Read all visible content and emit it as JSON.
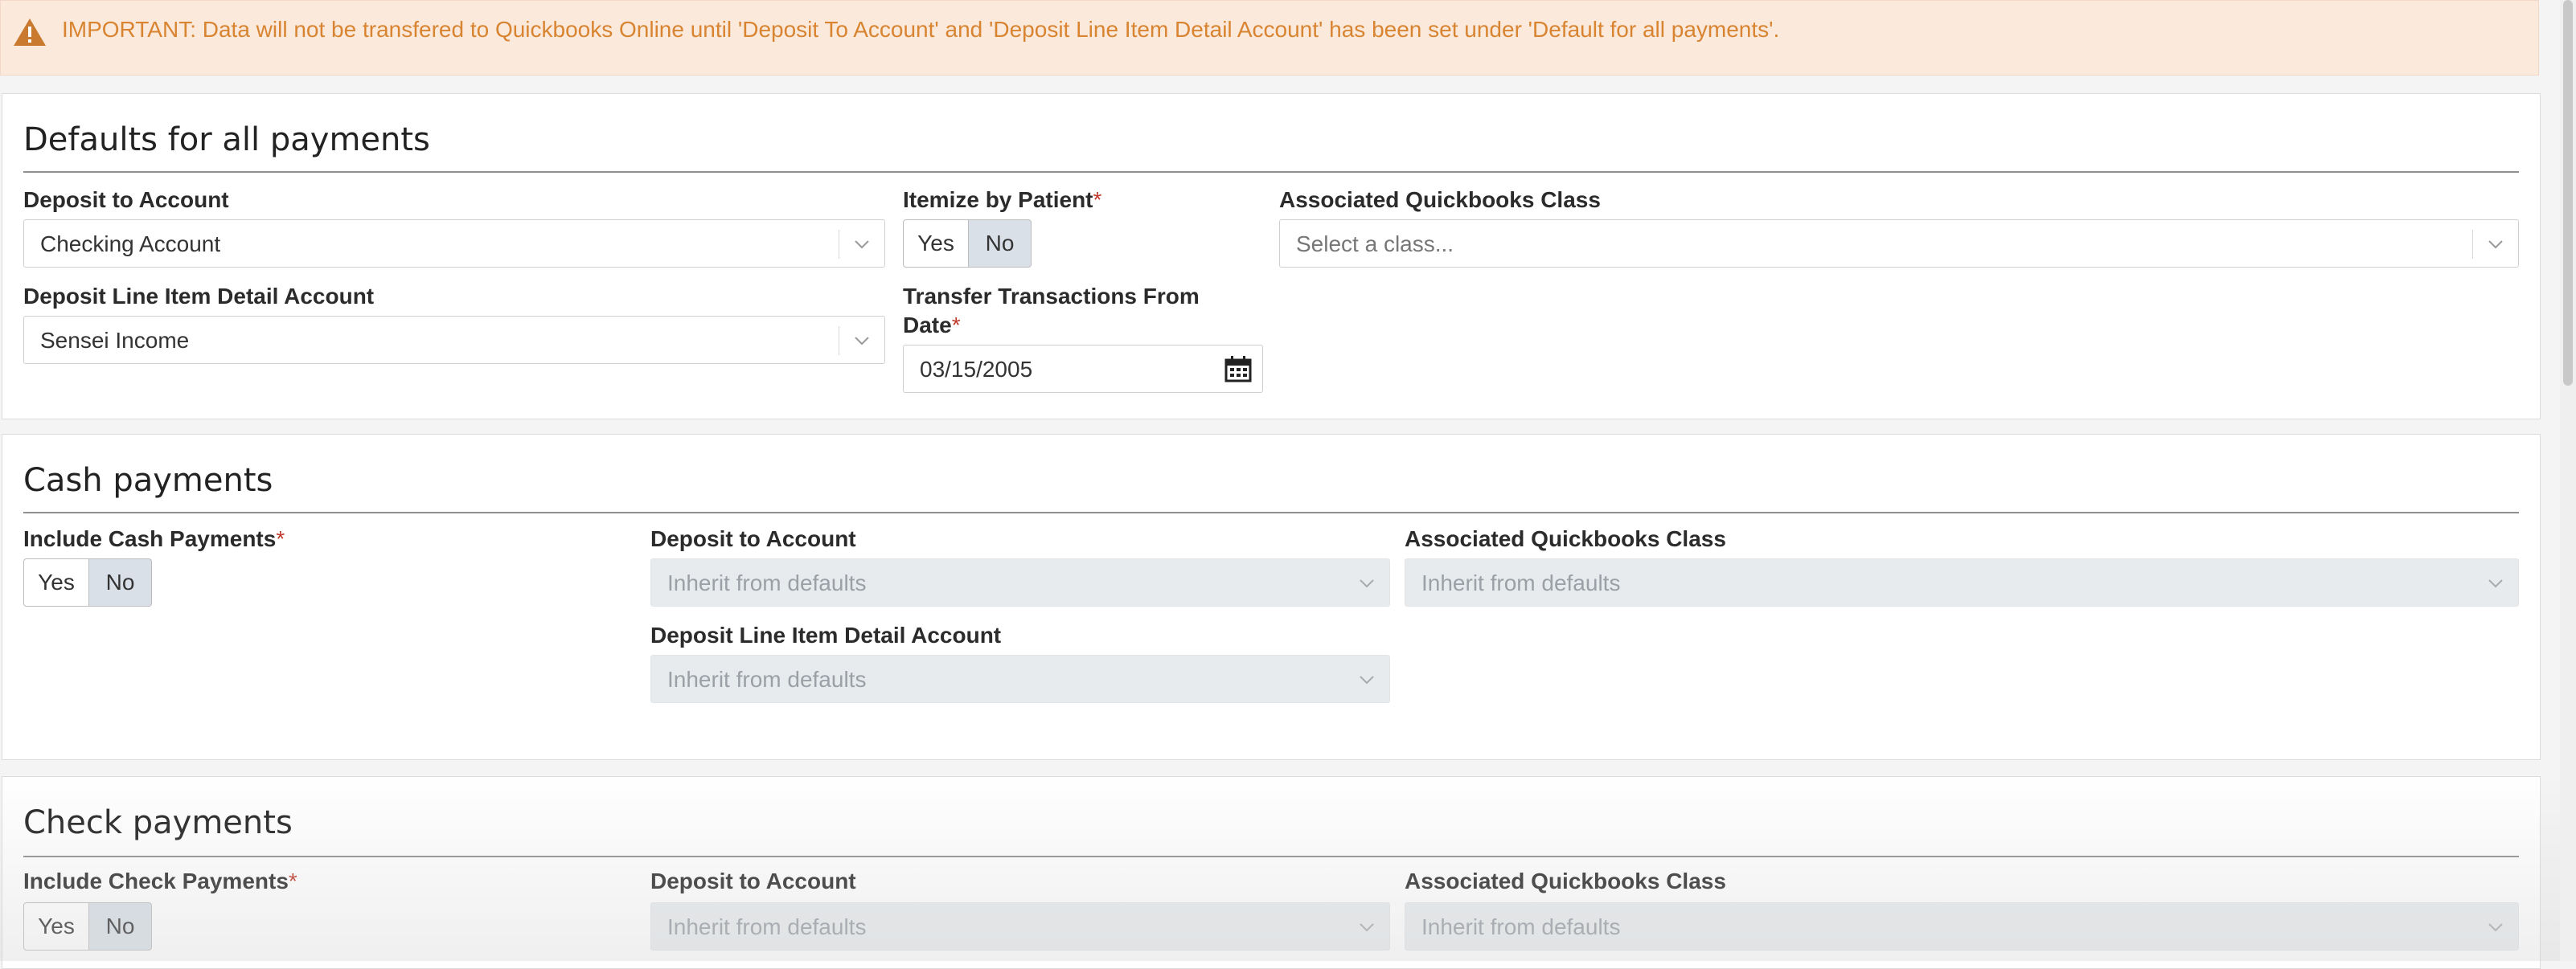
{
  "alert": {
    "icon": "warning-icon",
    "color": "#d88431",
    "message": "IMPORTANT: Data will not be transfered to Quickbooks Online until 'Deposit To Account' and 'Deposit Line Item Detail Account' has been set under 'Default for all payments'."
  },
  "defaults": {
    "title": "Defaults for all payments",
    "deposit_to_account": {
      "label": "Deposit to Account",
      "value": "Checking Account"
    },
    "itemize": {
      "label": "Itemize by Patient",
      "required": "*",
      "yes": "Yes",
      "no": "No",
      "selected": "No"
    },
    "class": {
      "label": "Associated Quickbooks Class",
      "placeholder": "Select a class..."
    },
    "line_item": {
      "label": "Deposit Line Item Detail Account",
      "value": "Sensei Income"
    },
    "transfer_from": {
      "label_line1": "Transfer Transactions From",
      "label_line2": "Date",
      "required": "*",
      "value": "03/15/2005"
    }
  },
  "cash": {
    "title": "Cash payments",
    "include": {
      "label": "Include Cash Payments",
      "required": "*",
      "yes": "Yes",
      "no": "No",
      "selected": "No"
    },
    "deposit_to_account": {
      "label": "Deposit to Account",
      "value": "Inherit from defaults"
    },
    "class": {
      "label": "Associated Quickbooks Class",
      "value": "Inherit from defaults"
    },
    "line_item": {
      "label": "Deposit Line Item Detail Account",
      "value": "Inherit from defaults"
    }
  },
  "check": {
    "title": "Check payments",
    "include": {
      "label": "Include Check Payments",
      "required": "*",
      "yes": "Yes",
      "no": "No",
      "selected": "No"
    },
    "deposit_to_account": {
      "label": "Deposit to Account",
      "value": "Inherit from defaults"
    },
    "class": {
      "label": "Associated Quickbooks Class",
      "value": "Inherit from defaults"
    }
  }
}
